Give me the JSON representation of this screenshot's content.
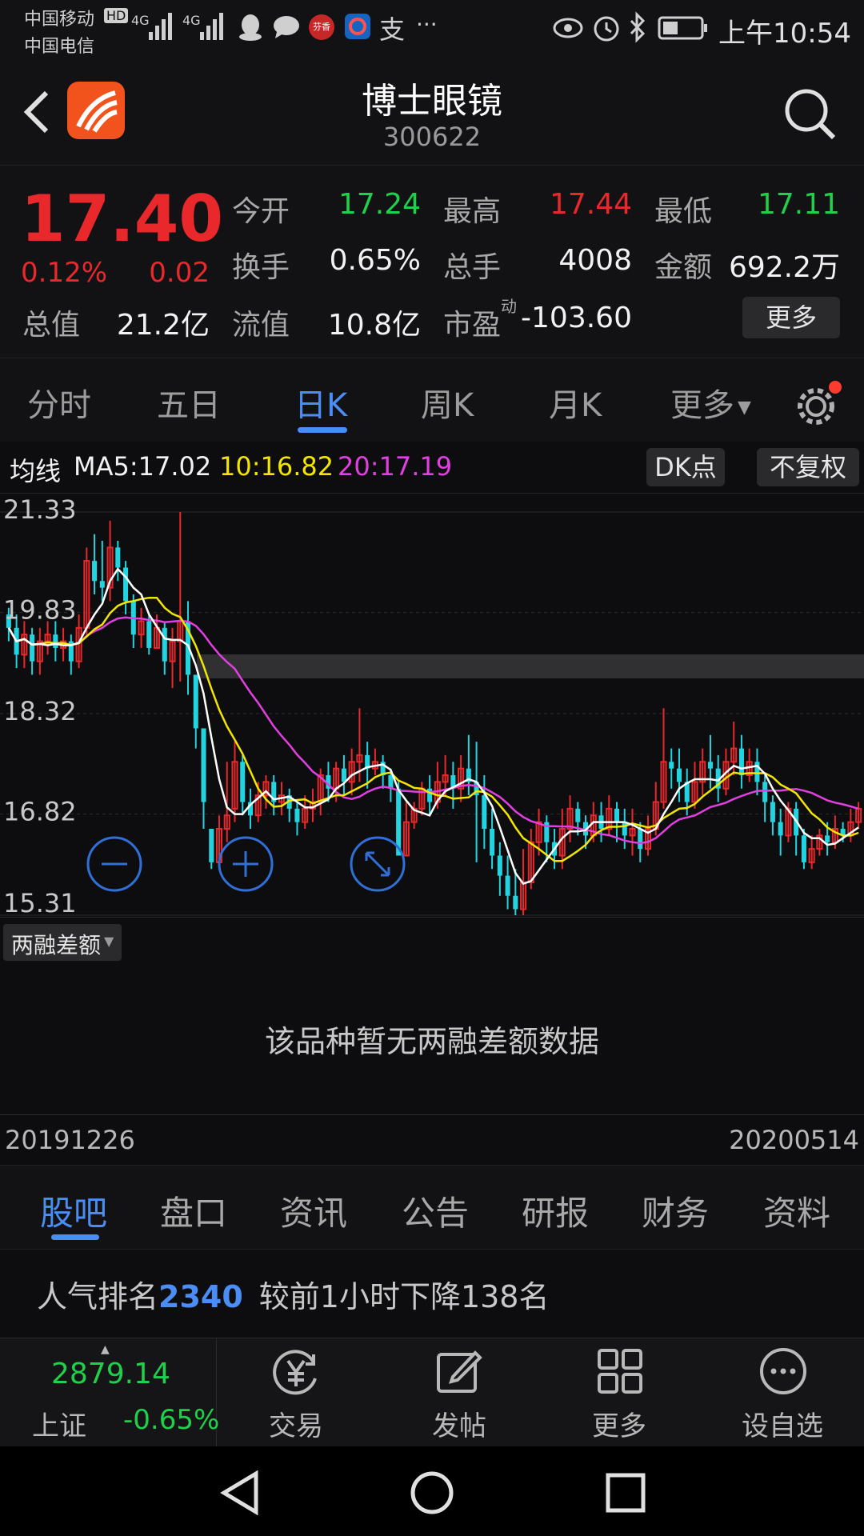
{
  "status_bar": {
    "carrier1": "中国移动",
    "carrier2": "中国电信",
    "hd": "HD",
    "net1": "4G",
    "net2": "4G",
    "app_badge": "芬香",
    "pay_glyph": "支",
    "dots": "···",
    "time": "上午10:54"
  },
  "header": {
    "name": "博士眼镜",
    "code": "300622"
  },
  "quote": {
    "price": "17.40",
    "change_pct": "0.12%",
    "change": "0.02",
    "total_value_label": "总值",
    "total_value": "21.2亿",
    "open_label": "今开",
    "open": "17.24",
    "high_label": "最高",
    "high": "17.44",
    "low_label": "最低",
    "low": "17.11",
    "turnover_label": "换手",
    "turnover": "0.65%",
    "volume_label": "总手",
    "volume": "4008",
    "amount_label": "金额",
    "amount": "692.2万",
    "float_label": "流值",
    "float_value": "10.8亿",
    "pe_label": "市盈",
    "pe_sup": "动",
    "pe": "-103.60",
    "more_btn": "更多"
  },
  "ktabs": [
    "分时",
    "五日",
    "日K",
    "周K",
    "月K",
    "更多"
  ],
  "ktab_active": 2,
  "ma": {
    "label": "均线",
    "ma5": "MA5:17.02",
    "ma10": "10:16.82",
    "ma20": "20:17.19",
    "dk_btn": "DK点",
    "fq_btn": "不复权"
  },
  "chart_data": {
    "type": "candlestick",
    "y_ticks": [
      "21.33",
      "19.83",
      "18.32",
      "16.82",
      "15.31"
    ],
    "ylim": [
      15.31,
      21.33
    ],
    "x_start": "20191226",
    "x_end": "20200514",
    "up_color": "#e8282b",
    "down_color": "#22d3e0",
    "ma5_color": "#ffffff",
    "ma10_color": "#f2e600",
    "ma20_color": "#e23fe0",
    "candles": [
      [
        19.8,
        19.6,
        19.9,
        19.4
      ],
      [
        19.6,
        19.2,
        19.8,
        19.0
      ],
      [
        19.2,
        19.5,
        19.7,
        19.0
      ],
      [
        19.5,
        19.1,
        19.6,
        18.9
      ],
      [
        19.1,
        19.4,
        19.6,
        18.9
      ],
      [
        19.4,
        19.5,
        19.7,
        19.2
      ],
      [
        19.5,
        19.3,
        19.7,
        19.1
      ],
      [
        19.3,
        19.4,
        19.6,
        19.1
      ],
      [
        19.4,
        19.1,
        19.5,
        18.9
      ],
      [
        19.1,
        19.6,
        19.8,
        19.0
      ],
      [
        19.6,
        20.6,
        20.8,
        19.5
      ],
      [
        20.6,
        20.3,
        21.0,
        20.1
      ],
      [
        20.3,
        20.2,
        20.9,
        20.0
      ],
      [
        20.2,
        20.8,
        21.2,
        20.0
      ],
      [
        20.8,
        20.5,
        20.9,
        20.3
      ],
      [
        20.5,
        20.0,
        20.6,
        19.8
      ],
      [
        20.0,
        19.5,
        20.1,
        19.3
      ],
      [
        19.5,
        19.7,
        19.9,
        19.3
      ],
      [
        19.7,
        19.3,
        19.8,
        19.2
      ],
      [
        19.3,
        19.6,
        19.8,
        19.3
      ],
      [
        19.6,
        19.1,
        19.7,
        18.9
      ],
      [
        19.1,
        19.4,
        19.6,
        18.7
      ],
      [
        19.4,
        19.7,
        21.33,
        18.8
      ],
      [
        19.7,
        18.9,
        20.0,
        18.6
      ],
      [
        18.9,
        18.1,
        18.3,
        17.8
      ],
      [
        18.1,
        17.0,
        17.3,
        16.6
      ],
      [
        16.6,
        16.1,
        16.5,
        16.0
      ],
      [
        16.1,
        16.6,
        16.8,
        16.0
      ],
      [
        16.6,
        16.8,
        17.6,
        16.4
      ],
      [
        16.9,
        17.6,
        17.9,
        16.7
      ],
      [
        17.6,
        17.0,
        17.7,
        16.8
      ],
      [
        17.0,
        16.8,
        17.2,
        16.6
      ],
      [
        16.8,
        17.1,
        17.3,
        16.7
      ],
      [
        17.1,
        17.3,
        17.4,
        16.9
      ],
      [
        17.3,
        17.0,
        17.4,
        16.8
      ],
      [
        17.0,
        17.1,
        17.3,
        16.8
      ],
      [
        17.1,
        16.9,
        17.2,
        16.7
      ],
      [
        16.9,
        16.7,
        17.0,
        16.5
      ],
      [
        16.7,
        16.9,
        17.1,
        16.6
      ],
      [
        16.9,
        17.0,
        17.2,
        16.7
      ],
      [
        17.0,
        17.4,
        17.5,
        16.8
      ],
      [
        17.4,
        17.2,
        17.6,
        17.0
      ],
      [
        17.2,
        17.5,
        17.6,
        17.0
      ],
      [
        17.5,
        17.3,
        17.7,
        17.1
      ],
      [
        17.3,
        17.6,
        17.8,
        17.1
      ],
      [
        17.6,
        17.7,
        18.4,
        17.3
      ],
      [
        17.7,
        17.5,
        17.9,
        17.2
      ],
      [
        17.5,
        17.6,
        17.8,
        17.4
      ],
      [
        17.6,
        17.4,
        17.7,
        17.2
      ],
      [
        17.4,
        17.2,
        17.5,
        17.0
      ],
      [
        17.2,
        16.2,
        17.3,
        16.2
      ],
      [
        16.2,
        16.7,
        17.0,
        16.2
      ],
      [
        16.7,
        16.9,
        17.0,
        16.6
      ],
      [
        16.9,
        17.2,
        17.3,
        16.8
      ],
      [
        17.2,
        17.0,
        17.4,
        16.8
      ],
      [
        17.0,
        17.3,
        17.6,
        16.9
      ],
      [
        17.3,
        17.4,
        17.7,
        17.1
      ],
      [
        17.4,
        17.2,
        17.6,
        16.9
      ],
      [
        17.2,
        17.5,
        17.7,
        17.0
      ],
      [
        17.5,
        17.3,
        18.0,
        17.1
      ],
      [
        17.3,
        17.1,
        17.9,
        16.1
      ],
      [
        17.1,
        16.6,
        17.4,
        16.3
      ],
      [
        16.6,
        16.2,
        16.9,
        16.0
      ],
      [
        16.2,
        15.9,
        16.4,
        15.6
      ],
      [
        15.9,
        15.6,
        16.2,
        15.4
      ],
      [
        15.6,
        15.4,
        16.0,
        15.31
      ],
      [
        15.4,
        15.8,
        16.3,
        15.31
      ],
      [
        15.8,
        16.4,
        16.6,
        15.7
      ],
      [
        16.4,
        16.7,
        16.9,
        16.2
      ],
      [
        16.7,
        16.4,
        16.8,
        16.1
      ],
      [
        16.4,
        16.2,
        16.6,
        16.0
      ],
      [
        16.2,
        16.6,
        16.9,
        16.0
      ],
      [
        16.6,
        16.9,
        17.1,
        16.4
      ],
      [
        16.9,
        16.7,
        17.0,
        16.5
      ],
      [
        16.7,
        16.5,
        16.8,
        16.3
      ],
      [
        16.5,
        16.8,
        17.0,
        16.4
      ],
      [
        16.8,
        16.6,
        17.0,
        16.4
      ],
      [
        16.6,
        16.9,
        17.1,
        16.5
      ],
      [
        16.9,
        16.7,
        17.0,
        16.4
      ],
      [
        16.7,
        16.5,
        16.9,
        16.3
      ],
      [
        16.5,
        16.6,
        16.9,
        16.2
      ],
      [
        16.6,
        16.3,
        16.7,
        16.1
      ],
      [
        16.3,
        16.6,
        16.8,
        16.2
      ],
      [
        16.6,
        17.0,
        17.3,
        16.5
      ],
      [
        17.0,
        17.6,
        18.4,
        16.9
      ],
      [
        17.6,
        17.5,
        17.8,
        17.2
      ],
      [
        17.5,
        17.3,
        17.8,
        17.0
      ],
      [
        17.3,
        17.0,
        17.5,
        16.8
      ],
      [
        17.0,
        17.3,
        17.6,
        16.9
      ],
      [
        17.3,
        17.6,
        17.8,
        17.1
      ],
      [
        17.6,
        17.5,
        18.0,
        17.2
      ],
      [
        17.5,
        17.2,
        17.7,
        17.0
      ],
      [
        17.2,
        17.6,
        17.8,
        17.1
      ],
      [
        17.6,
        17.8,
        18.2,
        17.4
      ],
      [
        17.8,
        17.4,
        18.0,
        17.2
      ],
      [
        17.4,
        17.6,
        17.8,
        17.3
      ],
      [
        17.6,
        17.3,
        17.8,
        17.1
      ],
      [
        17.3,
        17.0,
        17.4,
        16.7
      ],
      [
        17.0,
        16.7,
        17.1,
        16.5
      ],
      [
        16.7,
        16.5,
        16.9,
        16.2
      ],
      [
        16.5,
        16.9,
        17.0,
        16.4
      ],
      [
        16.9,
        16.5,
        17.0,
        16.2
      ],
      [
        16.5,
        16.1,
        16.6,
        16.0
      ],
      [
        16.1,
        16.3,
        16.5,
        16.0
      ],
      [
        16.3,
        16.5,
        16.6,
        16.2
      ],
      [
        16.5,
        16.4,
        16.7,
        16.2
      ],
      [
        16.4,
        16.6,
        16.8,
        16.3
      ],
      [
        16.6,
        16.5,
        16.7,
        16.4
      ],
      [
        16.5,
        16.7,
        16.9,
        16.4
      ],
      [
        16.7,
        16.9,
        17.0,
        16.6
      ]
    ]
  },
  "margin_panel": {
    "selector": "两融差额",
    "empty_text": "该品种暂无两融差额数据"
  },
  "info_tabs": [
    "股吧",
    "盘口",
    "资讯",
    "公告",
    "研报",
    "财务",
    "资料"
  ],
  "info_tab_active": 0,
  "popularity": {
    "prefix": "人气排名",
    "rank": "2340",
    "suffix": "较前1小时下降138名"
  },
  "index": {
    "value": "2879.14",
    "name": "上证",
    "change_pct": "-0.65%"
  },
  "toolbar": {
    "trade": "交易",
    "post": "发帖",
    "more": "更多",
    "watch": "设自选"
  }
}
